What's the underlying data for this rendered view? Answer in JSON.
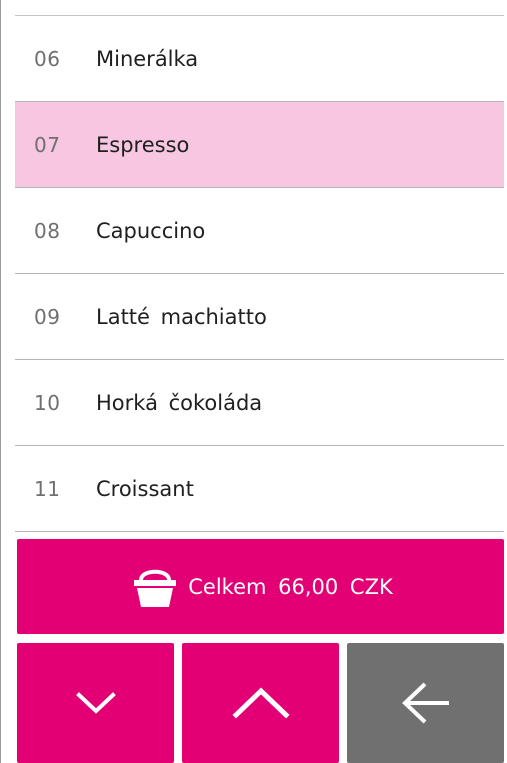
{
  "items": [
    {
      "code": "06",
      "name": "Minerálka",
      "selected": false
    },
    {
      "code": "07",
      "name": "Espresso",
      "selected": true
    },
    {
      "code": "08",
      "name": "Capuccino",
      "selected": false
    },
    {
      "code": "09",
      "name": "Latté machiatto",
      "selected": false
    },
    {
      "code": "10",
      "name": "Horká čokoláda",
      "selected": false
    },
    {
      "code": "11",
      "name": "Croissant",
      "selected": false
    }
  ],
  "total": {
    "label": "Celkem 66,00 CZK",
    "icon": "basket-icon"
  },
  "nav": {
    "down_icon": "chevron-down-icon",
    "up_icon": "chevron-up-icon",
    "back_icon": "arrow-left-icon"
  },
  "colors": {
    "accent": "#e20074",
    "selected_row": "#f7c6e0",
    "back_button": "#707070"
  }
}
